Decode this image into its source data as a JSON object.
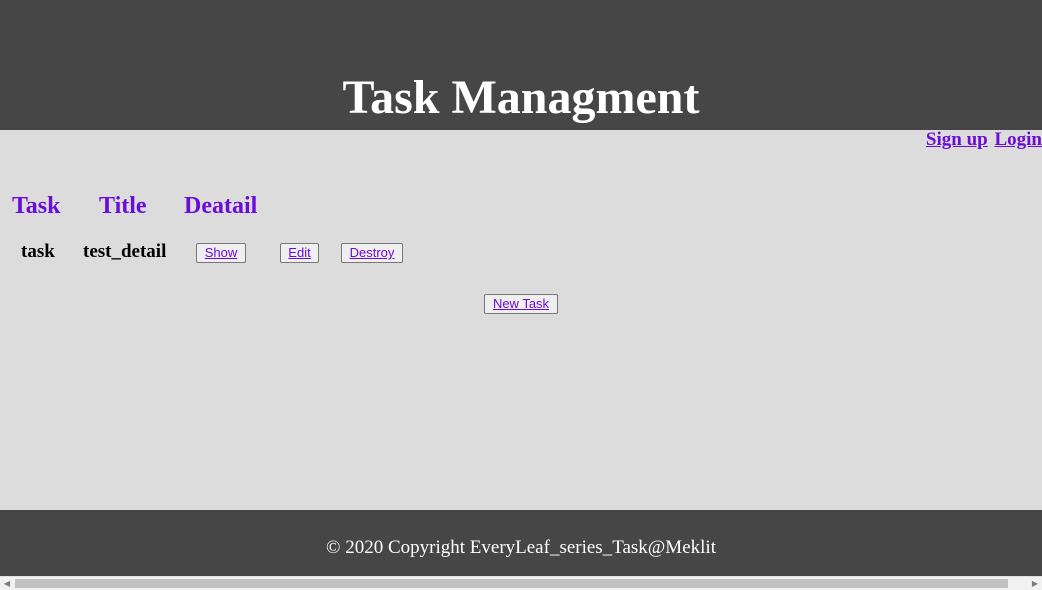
{
  "header": {
    "title": "Task Managment"
  },
  "auth": {
    "signup": "Sign up",
    "login": "Login"
  },
  "table": {
    "headers": [
      "Task",
      "Title",
      "Deatail"
    ],
    "rows": [
      {
        "task": "task",
        "title": "test_detail",
        "show": "Show",
        "edit": "Edit",
        "destroy": "Destroy"
      }
    ]
  },
  "new_task_label": "New Task",
  "footer": {
    "text": "© 2020 Copyright EveryLeaf_series_Task@Meklit"
  },
  "scrollbar": {
    "left_arrow": "◀",
    "right_arrow": "▶"
  }
}
